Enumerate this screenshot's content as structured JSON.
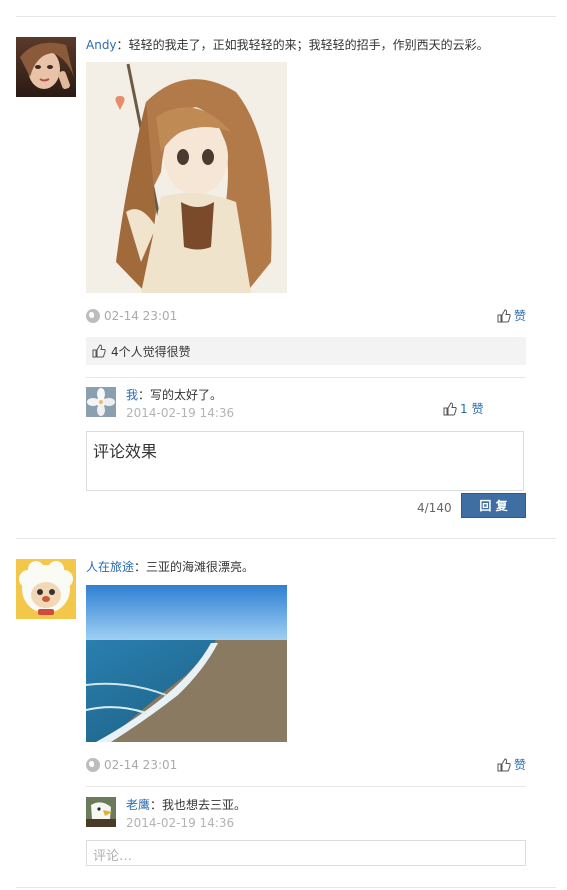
{
  "posts": [
    {
      "author": "Andy",
      "separator": "：",
      "text": "轻轻的我走了，正如我轻轻的来；我轻轻的招手，作别西天的云彩。",
      "time": "02-14 23:01",
      "like_label": "赞",
      "likes_summary": "4个人觉得很赞",
      "replies": [
        {
          "author": "我",
          "separator": "：",
          "text": "写的太好了。",
          "time": "2014-02-19 14:36",
          "like_count": "1",
          "like_label": "赞"
        }
      ],
      "comment_value": "评论效果",
      "counter": "4/140",
      "reply_button": "回 复"
    },
    {
      "author": "人在旅途",
      "separator": "：",
      "text": "三亚的海滩很漂亮。",
      "time": "02-14 23:01",
      "like_label": "赞",
      "replies": [
        {
          "author": "老鹰",
          "separator": "：",
          "text": "我也想去三亚。",
          "time": "2014-02-19 14:36"
        }
      ],
      "comment_placeholder": "评论…"
    }
  ],
  "colors": {
    "link": "#2a6bb0",
    "muted": "#aaaaaa",
    "button": "#3f6ea3",
    "divider": "#e6e6e6",
    "likes_bar": "#f3f3f3"
  },
  "icons": [
    "globe-icon",
    "thumbs-up-icon"
  ]
}
